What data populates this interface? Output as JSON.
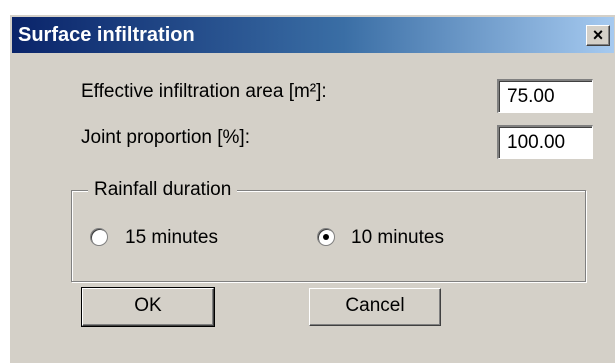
{
  "dialog": {
    "title": "Surface infiltration",
    "close_glyph": "×",
    "close_icon": "close-icon"
  },
  "fields": {
    "area_label": "Effective infiltration area [m²]:",
    "area_value": "75.00",
    "joint_label": "Joint proportion [%]:",
    "joint_value": "100.00"
  },
  "rainfall": {
    "legend": "Rainfall duration",
    "options": [
      {
        "label": "15 minutes",
        "selected": false
      },
      {
        "label": "10 minutes",
        "selected": true
      }
    ]
  },
  "buttons": {
    "ok": "OK",
    "cancel": "Cancel"
  },
  "colors": {
    "window_bg": "#d4d0c8",
    "title_gradient_start": "#0a246a",
    "title_gradient_end": "#a6caf0"
  }
}
